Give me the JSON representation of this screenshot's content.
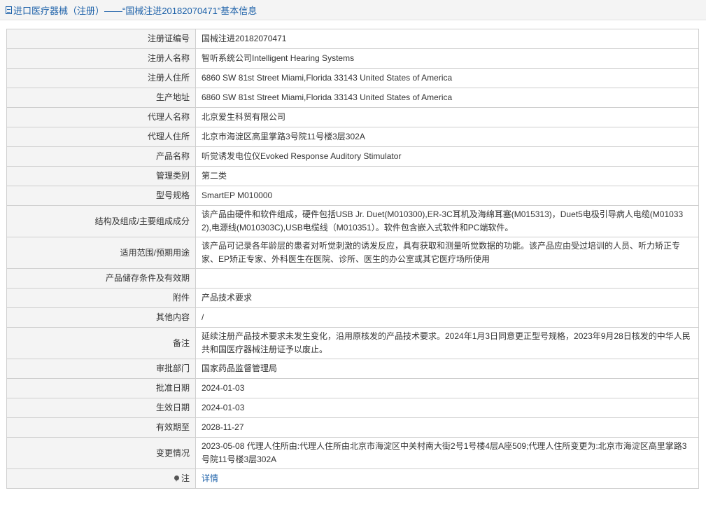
{
  "header": {
    "title": "进口医疗器械（注册）——“国械注进20182070471”基本信息"
  },
  "rows": [
    {
      "label": "注册证编号",
      "value": "国械注进20182070471"
    },
    {
      "label": "注册人名称",
      "value": "智听系统公司Intelligent Hearing Systems"
    },
    {
      "label": "注册人住所",
      "value": "6860 SW 81st Street Miami,Florida 33143 United States of America"
    },
    {
      "label": "生产地址",
      "value": "6860 SW 81st Street Miami,Florida 33143 United States of America"
    },
    {
      "label": "代理人名称",
      "value": "北京爱生科贸有限公司"
    },
    {
      "label": "代理人住所",
      "value": "北京市海淀区高里掌路3号院11号楼3层302A"
    },
    {
      "label": "产品名称",
      "value": "听觉诱发电位仪Evoked Response Auditory Stimulator"
    },
    {
      "label": "管理类别",
      "value": "第二类"
    },
    {
      "label": "型号规格",
      "value": "SmartEP M010000"
    },
    {
      "label": "结构及组成/主要组成成分",
      "value": "该产品由硬件和软件组成，硬件包括USB Jr. Duet(M010300),ER-3C耳机及海绵耳塞(M015313)，Duet5电极引导病人电缆(M010332),电源线(M010303C),USB电缆线（M010351）。软件包含嵌入式软件和PC端软件。"
    },
    {
      "label": "适用范围/预期用途",
      "value": "该产品可记录各年龄层的患者对听觉刺激的诱发反应，具有获取和测量听觉数据的功能。该产品应由受过培训的人员、听力矫正专家、EP矫正专家、外科医生在医院、诊所、医生的办公室或其它医疗场所使用"
    },
    {
      "label": "产品储存条件及有效期",
      "value": ""
    },
    {
      "label": "附件",
      "value": "产品技术要求"
    },
    {
      "label": "其他内容",
      "value": "/"
    },
    {
      "label": "备注",
      "value": "延续注册产品技术要求未发生变化，沿用原核发的产品技术要求。2024年1月3日同意更正型号规格，2023年9月28日核发的中华人民共和国医疗器械注册证予以废止。"
    },
    {
      "label": "审批部门",
      "value": "国家药品监督管理局"
    },
    {
      "label": "批准日期",
      "value": "2024-01-03"
    },
    {
      "label": "生效日期",
      "value": "2024-01-03"
    },
    {
      "label": "有效期至",
      "value": "2028-11-27"
    },
    {
      "label": "变更情况",
      "value": "2023-05-08 代理人住所由:代理人住所由北京市海淀区中关村南大街2号1号楼4层A座509;代理人住所变更为:北京市海淀区高里掌路3号院11号楼3层302A"
    }
  ],
  "note": {
    "label": "注",
    "icon": "pin-icon",
    "link_text": "详情"
  },
  "colors": {
    "link": "#1a5fa8",
    "label_bg": "#f4f4f4",
    "border": "#cfcfcf"
  }
}
